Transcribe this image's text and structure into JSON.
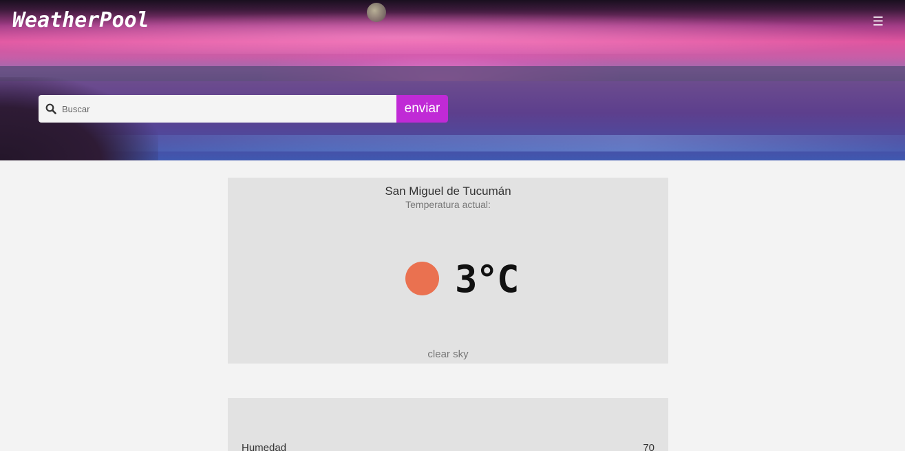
{
  "header": {
    "brand": "WeatherPool",
    "menu_icon": "hamburger-menu-icon"
  },
  "search": {
    "placeholder": "Buscar",
    "value": "",
    "button_label": "enviar",
    "icon": "search-icon"
  },
  "current": {
    "city": "San Miguel de Tucumán",
    "subtitle": "Temperatura actual:",
    "temperature": "3°C",
    "description": "clear sky",
    "icon": "sun-icon"
  },
  "details": {
    "rows": [
      {
        "label": "Humedad",
        "value": "70"
      }
    ]
  },
  "colors": {
    "accent": "#c02ad6",
    "sun": "#ea7150",
    "card": "#e2e2e2",
    "page_bg": "#f3f3f3"
  }
}
